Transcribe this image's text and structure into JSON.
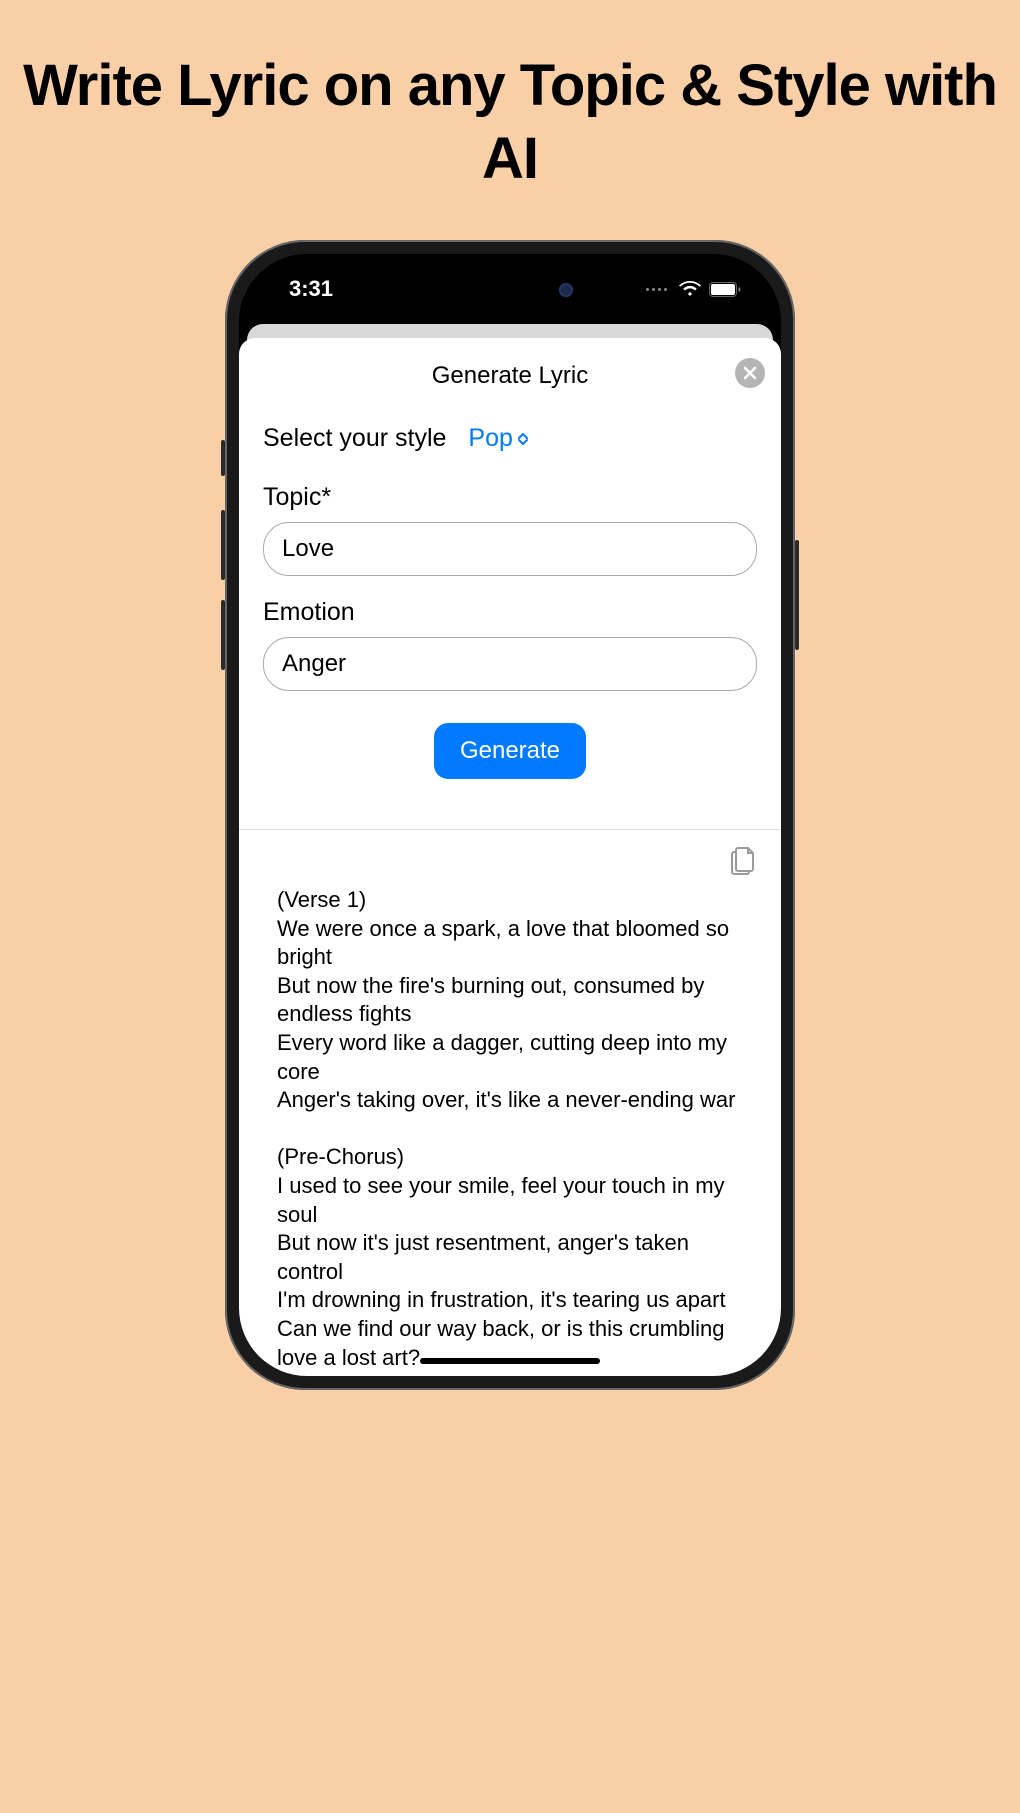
{
  "headline": "Write Lyric on any Topic & Style with AI",
  "statusBar": {
    "time": "3:31"
  },
  "sheet": {
    "title": "Generate Lyric",
    "styleLabel": "Select your style",
    "styleValue": "Pop",
    "topicLabel": "Topic*",
    "topicValue": "Love",
    "emotionLabel": "Emotion",
    "emotionValue": "Anger",
    "generateLabel": "Generate"
  },
  "lyrics": "(Verse 1)\nWe were once a spark, a love that bloomed so bright\nBut now the fire's burning out, consumed by endless fights\nEvery word like a dagger, cutting deep into my core\nAnger's taking over, it's like a never-ending war\n\n(Pre-Chorus)\nI used to see your smile, feel your touch in my soul\nBut now it's just resentment, anger's taken control\nI'm drowning in frustration, it's tearing us apart\nCan we find our way back, or is this crumbling love a lost art?"
}
